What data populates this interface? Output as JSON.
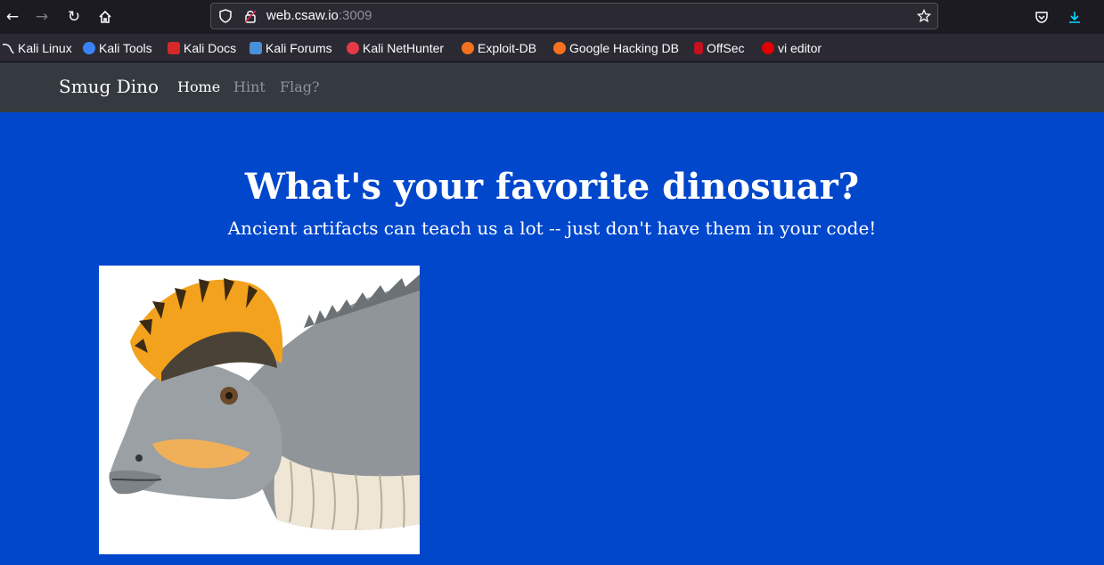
{
  "browser": {
    "url_host": "web.csaw.io",
    "url_port": ":3009",
    "icons": [
      "back-arrow-icon",
      "forward-arrow-icon",
      "reload-icon",
      "home-icon",
      "shield-icon",
      "lock-icon",
      "star-icon",
      "pocket-icon",
      "download-icon"
    ]
  },
  "bookmarks": [
    {
      "label": "Kali Linux"
    },
    {
      "label": "Kali Tools"
    },
    {
      "label": "Kali Docs"
    },
    {
      "label": "Kali Forums"
    },
    {
      "label": "Kali NetHunter"
    },
    {
      "label": "Exploit-DB"
    },
    {
      "label": "Google Hacking DB"
    },
    {
      "label": "OffSec"
    },
    {
      "label": "vi editor"
    }
  ],
  "navbar": {
    "brand": "Smug Dino",
    "links": [
      {
        "label": "Home"
      },
      {
        "label": "Hint"
      },
      {
        "label": "Flag?"
      }
    ]
  },
  "hero": {
    "title": "What's your favorite dinosuar?",
    "subtitle": "Ancient artifacts can teach us a lot -- just don't have them in your code!"
  },
  "colors": {
    "page_bg": "#0047cc",
    "navbar_bg": "#343a40",
    "browser_bg": "#1c1b22"
  }
}
